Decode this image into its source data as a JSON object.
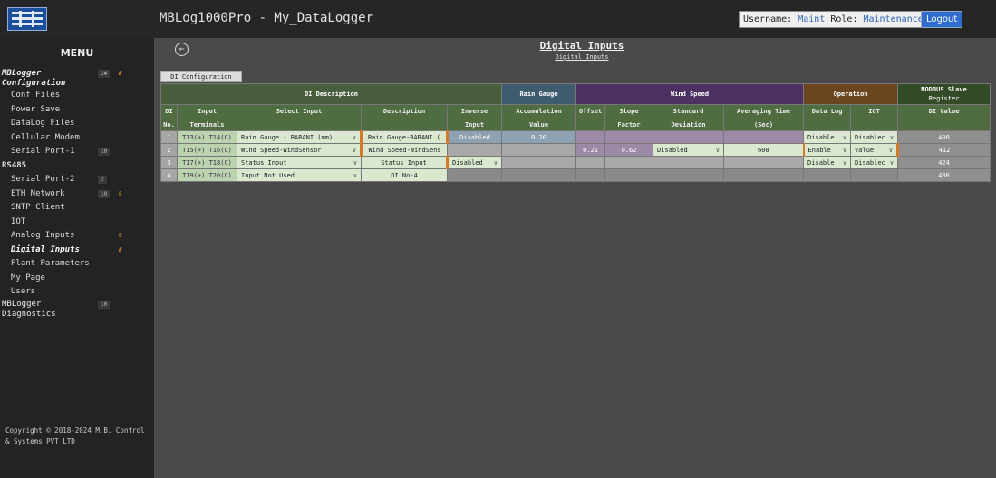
{
  "app": {
    "title": "MBLog1000Pro - My_DataLogger",
    "username_label": "Username:",
    "username": "Maint",
    "role_label": "Role:",
    "role": "Maintenance",
    "logout": "Logout"
  },
  "sidebar": {
    "menu": "MENU",
    "group1": {
      "label": "MBLogger Configuration",
      "badge": "14",
      "flag": "E"
    },
    "items": [
      {
        "label": "Conf Files",
        "badge": "",
        "flag": ""
      },
      {
        "label": "Power Save",
        "badge": "",
        "flag": ""
      },
      {
        "label": "DataLog Files",
        "badge": "",
        "flag": ""
      },
      {
        "label": "Cellular Modem",
        "badge": "",
        "flag": ""
      },
      {
        "label": "Serial Port-1",
        "badge": "10",
        "flag": ""
      },
      {
        "label": "RS485",
        "badge": "",
        "flag": ""
      },
      {
        "label": "Serial Port-2",
        "badge": "2",
        "flag": ""
      },
      {
        "label": "ETH Network",
        "badge": "10",
        "flag": "E"
      },
      {
        "label": "SNTP Client",
        "badge": "",
        "flag": ""
      },
      {
        "label": "IOT",
        "badge": "",
        "flag": ""
      },
      {
        "label": "Analog Inputs",
        "badge": "",
        "flag": "E"
      },
      {
        "label": "Digital Inputs",
        "badge": "",
        "flag": "E"
      },
      {
        "label": "Plant Parameters",
        "badge": "",
        "flag": ""
      },
      {
        "label": "My Page",
        "badge": "",
        "flag": ""
      },
      {
        "label": "Users",
        "badge": "",
        "flag": ""
      }
    ],
    "group2": {
      "label": "MBLogger Diagnostics",
      "badge": "10"
    },
    "copyright": "Copyright © 2018-2024 M.B. Control & Systems PVT LTD"
  },
  "page": {
    "title": "Digital Inputs",
    "subtitle": "Digital Inputs",
    "tab": "DI Configuration"
  },
  "table": {
    "groups": {
      "desc": "DI Description",
      "rain": "Rain Gauge",
      "wind": "Wind Speed",
      "op": "Operation",
      "mod1": "MODBUS Slave",
      "mod2": "Register"
    },
    "h1": {
      "dino": "DI",
      "term": "Input",
      "sel": "Select Input",
      "desc": "Description",
      "inv": "Inverse",
      "acc": "Accumulation",
      "off": "Offset",
      "slope": "Slope",
      "std": "Standard",
      "avg": "Averaging Time",
      "dlog": "Data Log",
      "iot": "IOT",
      "mb": "DI Value"
    },
    "h2": {
      "dino": "No.",
      "term": "Terminals",
      "inv": "Input",
      "acc": "Value",
      "slope": "Factor",
      "std": "Deviation",
      "avg": "(Sec)"
    },
    "rows": [
      {
        "no": "1",
        "term": "T13(+) T14(C)",
        "sel": "Rain Gauge - BARANI (mm)",
        "desc": "Rain Gauge-BARANI (",
        "inv": "Disabled",
        "acc": "0.20",
        "off": "",
        "slope": "",
        "std": "",
        "avg": "",
        "dlog": "Disable",
        "iot": "Disablec",
        "mb": "400"
      },
      {
        "no": "2",
        "term": "T15(+) T16(C)",
        "sel": "Wind Speed-WindSensor",
        "desc": "Wind Speed-WindSens",
        "inv": "",
        "acc": "",
        "off": "0.21",
        "slope": "0.62",
        "std": "Disabled",
        "avg": "600",
        "dlog": "Enable",
        "iot": "Value",
        "mb": "412"
      },
      {
        "no": "3",
        "term": "T17(+) T18(C)",
        "sel": "Status Input",
        "desc": "Status Input",
        "inv": "Disabled",
        "acc": "",
        "off": "",
        "slope": "",
        "std": "",
        "avg": "",
        "dlog": "Disable",
        "iot": "Disablec",
        "mb": "424"
      },
      {
        "no": "4",
        "term": "T19(+) T20(C)",
        "sel": "Input Not Used",
        "desc": "DI No-4",
        "inv": "",
        "acc": "",
        "off": "",
        "slope": "",
        "std": "",
        "avg": "",
        "dlog": "",
        "iot": "",
        "mb": "436"
      }
    ]
  },
  "icons": {
    "back": "back-arrow-icon",
    "dropdown": "chevron-down-icon"
  },
  "colors": {
    "desc": "#495e3c",
    "rain": "#3f5c6e",
    "wind": "#4d3062",
    "op": "#6b4520",
    "modbus": "#344b28",
    "accent": "#2f6bd0",
    "flag": "#e2a040"
  }
}
